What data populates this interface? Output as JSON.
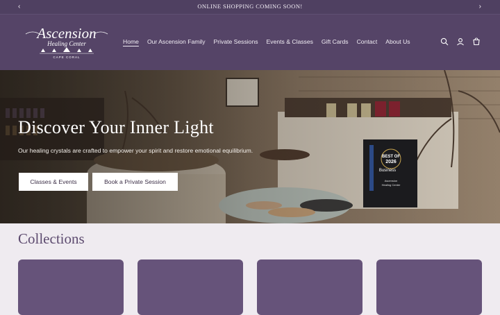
{
  "announcement": {
    "text": "ONLINE SHOPPING COMING SOON!",
    "prev_icon": "chevron-left-icon",
    "next_icon": "chevron-right-icon"
  },
  "header": {
    "logo": {
      "line1": "Ascension",
      "line2": "Healing Center",
      "line3": "CAPE CORAL"
    },
    "nav": [
      "Home",
      "Our Ascension Family",
      "Private Sessions",
      "Events & Classes",
      "Gift Cards",
      "Contact",
      "About Us"
    ],
    "active_nav": "Home",
    "icons": [
      "search-icon",
      "account-icon",
      "cart-icon"
    ]
  },
  "hero": {
    "title": "Discover Your Inner Light",
    "subtitle": "Our healing crystals are crafted to empower your spirit and restore emotional equilibrium.",
    "buttons": {
      "primary": "Classes & Events",
      "secondary": "Book a Private Session"
    },
    "award": {
      "line1": "BEST OF",
      "line2": "2026",
      "line3": "Business",
      "line4": "Ascension",
      "line5": "Healing Center"
    }
  },
  "collections": {
    "title": "Collections"
  },
  "colors": {
    "header_bg": "#554467",
    "announce_bg": "#4f4061",
    "card_bg": "#66537a",
    "page_bg": "#efebf0",
    "heading": "#5d4b6f"
  }
}
